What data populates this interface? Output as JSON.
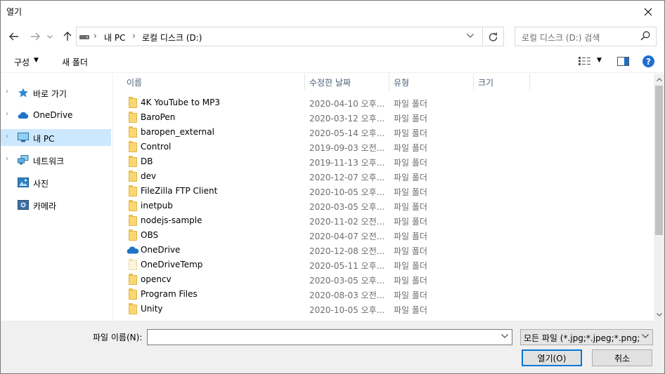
{
  "window": {
    "title": "열기"
  },
  "nav": {
    "breadcrumbs": [
      "내 PC",
      "로컬 디스크 (D:)"
    ],
    "search_placeholder": "로컬 디스크 (D:) 검색"
  },
  "toolbar": {
    "organize": "구성",
    "new_folder": "새 폴더"
  },
  "sidebar": {
    "items": [
      {
        "label": "바로 가기",
        "icon": "star-icon"
      },
      {
        "label": "OneDrive",
        "icon": "cloud-icon"
      },
      {
        "label": "내 PC",
        "icon": "monitor-icon",
        "selected": true
      },
      {
        "label": "네트워크",
        "icon": "network-icon"
      },
      {
        "label": "사진",
        "icon": "photos-icon"
      },
      {
        "label": "카메라",
        "icon": "camera-icon"
      }
    ]
  },
  "columns": {
    "name": "이름",
    "date": "수정한 날짜",
    "type": "유형",
    "size": "크기"
  },
  "files": [
    {
      "name": "4K YouTube to MP3",
      "date": "2020-04-10 오후...",
      "type": "파일 폴더",
      "icon": "folder-icon"
    },
    {
      "name": "BaroPen",
      "date": "2020-03-12 오후...",
      "type": "파일 폴더",
      "icon": "folder-icon"
    },
    {
      "name": "baropen_external",
      "date": "2020-05-14 오후...",
      "type": "파일 폴더",
      "icon": "folder-icon"
    },
    {
      "name": "Control",
      "date": "2019-09-03 오전...",
      "type": "파일 폴더",
      "icon": "folder-icon"
    },
    {
      "name": "DB",
      "date": "2019-11-13 오후...",
      "type": "파일 폴더",
      "icon": "folder-icon"
    },
    {
      "name": "dev",
      "date": "2020-12-07 오후...",
      "type": "파일 폴더",
      "icon": "folder-icon"
    },
    {
      "name": "FileZilla FTP Client",
      "date": "2020-10-05 오후...",
      "type": "파일 폴더",
      "icon": "folder-icon"
    },
    {
      "name": "inetpub",
      "date": "2020-03-05 오후...",
      "type": "파일 폴더",
      "icon": "folder-icon"
    },
    {
      "name": "nodejs-sample",
      "date": "2020-11-02 오전...",
      "type": "파일 폴더",
      "icon": "folder-icon"
    },
    {
      "name": "OBS",
      "date": "2020-04-07 오전...",
      "type": "파일 폴더",
      "icon": "folder-icon"
    },
    {
      "name": "OneDrive",
      "date": "2020-12-08 오전...",
      "type": "파일 폴더",
      "icon": "onedrive-icon"
    },
    {
      "name": "OneDriveTemp",
      "date": "2020-05-11 오후...",
      "type": "파일 폴더",
      "icon": "folder-icon-pale"
    },
    {
      "name": "opencv",
      "date": "2020-03-05 오후...",
      "type": "파일 폴더",
      "icon": "folder-icon"
    },
    {
      "name": "Program Files",
      "date": "2020-08-03 오전...",
      "type": "파일 폴더",
      "icon": "folder-icon"
    },
    {
      "name": "Unity",
      "date": "2020-10-05 오후...",
      "type": "파일 폴더",
      "icon": "folder-icon"
    }
  ],
  "bottom": {
    "filename_label": "파일 이름(N):",
    "filename_value": "",
    "filter": "모든 파일 (*.jpg;*.jpeg;*.png;*.l",
    "open_button": "열기(O)",
    "cancel_button": "취소"
  }
}
